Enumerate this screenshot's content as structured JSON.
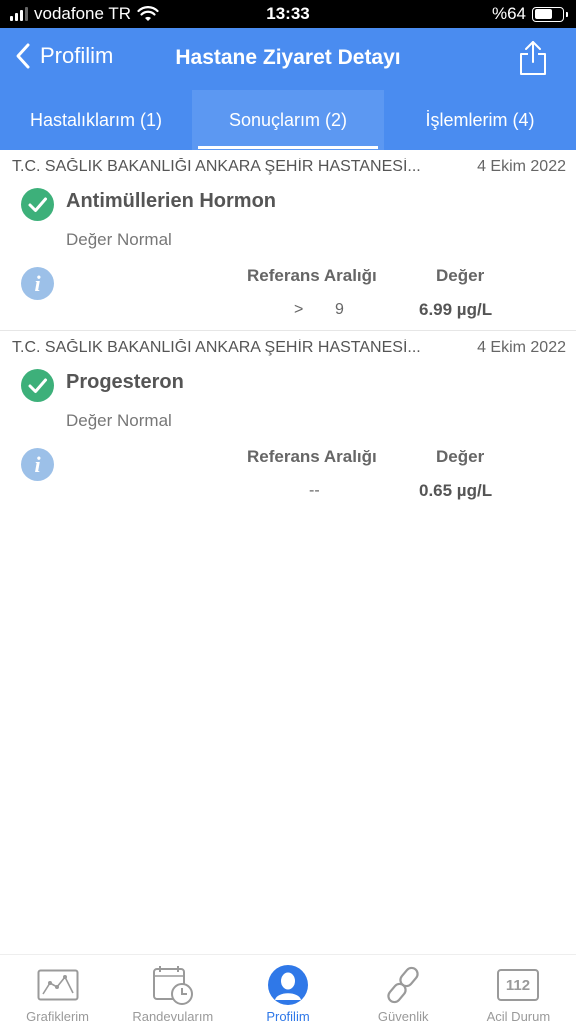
{
  "status_bar": {
    "carrier": "vodafone TR",
    "time": "13:33",
    "battery": "%64",
    "battery_level": 0.64
  },
  "header": {
    "back_label": "Profilim",
    "title": "Hastane Ziyaret Detayı"
  },
  "tabs": [
    {
      "label": "Hastalıklarım (1)",
      "active": false
    },
    {
      "label": "Sonuçlarım (2)",
      "active": true
    },
    {
      "label": "İşlemlerim (4)",
      "active": false
    }
  ],
  "results": [
    {
      "hospital": "T.C. SAĞLIK BAKANLIĞI ANKARA ŞEHİR HASTANESİ...",
      "date": "4 Ekim 2022",
      "test_name": "Antimüllerien Hormon",
      "status": "Değer Normal",
      "ref_label": "Referans Aralığı",
      "value_label": "Değer",
      "ref_operator": ">",
      "ref_value": "9",
      "value": "6.99 µg/L"
    },
    {
      "hospital": "T.C. SAĞLIK BAKANLIĞI ANKARA ŞEHİR HASTANESİ...",
      "date": "4 Ekim 2022",
      "test_name": "Progesteron",
      "status": "Değer Normal",
      "ref_label": "Referans Aralığı",
      "value_label": "Değer",
      "ref_range": "--",
      "value": "0.65 µg/L"
    }
  ],
  "bottom_nav": [
    {
      "label": "Grafiklerim",
      "icon": "chart-icon",
      "active": false
    },
    {
      "label": "Randevularım",
      "icon": "calendar-clock-icon",
      "active": false
    },
    {
      "label": "Profilim",
      "icon": "profile-icon",
      "active": true
    },
    {
      "label": "Güvenlik",
      "icon": "link-icon",
      "active": false
    },
    {
      "label": "Acil Durum",
      "icon": "emergency-112-icon",
      "icon_text": "112",
      "active": false
    }
  ],
  "colors": {
    "primary": "#4a8cf0",
    "check_green": "#3db07a",
    "info_blue": "#9cc0e8",
    "nav_active": "#2f78e8"
  }
}
